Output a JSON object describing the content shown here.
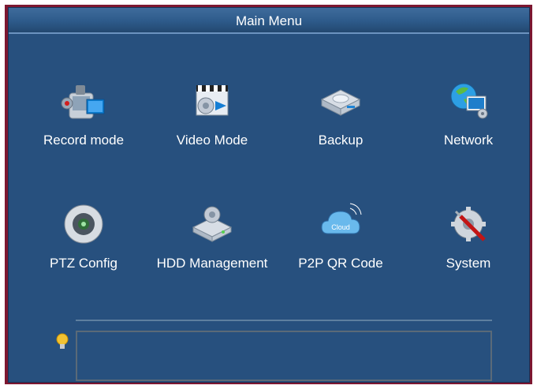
{
  "window": {
    "title": "Main Menu"
  },
  "menu": {
    "items": [
      {
        "label": "Record mode",
        "icon": "camcorder-icon"
      },
      {
        "label": "Video Mode",
        "icon": "clapperboard-gear-icon"
      },
      {
        "label": "Backup",
        "icon": "disk-drive-icon"
      },
      {
        "label": "Network",
        "icon": "globe-monitor-icon"
      },
      {
        "label": "PTZ Config",
        "icon": "dome-camera-icon"
      },
      {
        "label": "HDD Management",
        "icon": "hdd-gear-icon"
      },
      {
        "label": "P2P QR Code",
        "icon": "cloud-icon"
      },
      {
        "label": "System",
        "icon": "gear-screwdriver-icon"
      }
    ],
    "cloud_text": "Cloud"
  },
  "hint": {
    "icon": "lightbulb-icon",
    "text": ""
  },
  "colors": {
    "frame": "#7d1730",
    "panel": "#27507e",
    "title_bar": "#2d5a8a",
    "text": "#ffffff"
  }
}
